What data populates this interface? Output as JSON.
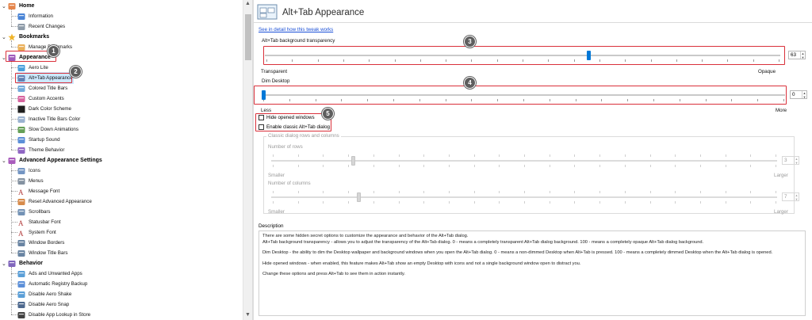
{
  "tree": {
    "items": [
      {
        "type": "cat",
        "label": "Home",
        "icon": "home-icon"
      },
      {
        "type": "item",
        "label": "Information",
        "icon": "info-icon"
      },
      {
        "type": "item",
        "label": "Recent Changes",
        "icon": "recent-icon"
      },
      {
        "type": "cat",
        "label": "Bookmarks",
        "icon": "star-icon"
      },
      {
        "type": "item",
        "label": "Manage Bookmarks",
        "icon": "bookmark-icon"
      },
      {
        "type": "cat",
        "label": "Appearance",
        "icon": "appearance-icon"
      },
      {
        "type": "item",
        "label": "Aero Lite",
        "icon": "aero-lite-icon"
      },
      {
        "type": "item",
        "label": "Alt+Tab Appearance",
        "icon": "alt-tab-icon",
        "selected": true
      },
      {
        "type": "item",
        "label": "Colored Title Bars",
        "icon": "title-bars-icon"
      },
      {
        "type": "item",
        "label": "Custom Accents",
        "icon": "accents-icon"
      },
      {
        "type": "item",
        "label": "Dark Color Scheme",
        "icon": "dark-scheme-icon"
      },
      {
        "type": "item",
        "label": "Inactive Title Bars Color",
        "icon": "inactive-title-icon"
      },
      {
        "type": "item",
        "label": "Slow Down Animations",
        "icon": "animations-icon"
      },
      {
        "type": "item",
        "label": "Startup Sound",
        "icon": "sound-icon"
      },
      {
        "type": "item",
        "label": "Theme Behavior",
        "icon": "theme-icon"
      },
      {
        "type": "cat",
        "label": "Advanced Appearance Settings",
        "icon": "advanced-appearance-icon"
      },
      {
        "type": "item",
        "label": "Icons",
        "icon": "icons-icon"
      },
      {
        "type": "item",
        "label": "Menus",
        "icon": "menus-icon"
      },
      {
        "type": "item",
        "label": "Message Font",
        "icon": "font-icon"
      },
      {
        "type": "item",
        "label": "Reset Advanced Appearance",
        "icon": "reset-icon"
      },
      {
        "type": "item",
        "label": "Scrollbars",
        "icon": "scrollbars-icon"
      },
      {
        "type": "item",
        "label": "Statusbar Font",
        "icon": "font-icon"
      },
      {
        "type": "item",
        "label": "System Font",
        "icon": "font-icon"
      },
      {
        "type": "item",
        "label": "Window Borders",
        "icon": "window-icon"
      },
      {
        "type": "item",
        "label": "Window Title Bars",
        "icon": "window-icon"
      },
      {
        "type": "cat",
        "label": "Behavior",
        "icon": "behavior-icon"
      },
      {
        "type": "item",
        "label": "Ads and Unwanted Apps",
        "icon": "ads-icon"
      },
      {
        "type": "item",
        "label": "Automatic Registry Backup",
        "icon": "registry-icon"
      },
      {
        "type": "item",
        "label": "Disable Aero Shake",
        "icon": "aero-shake-icon"
      },
      {
        "type": "item",
        "label": "Disable Aero Snap",
        "icon": "aero-snap-icon"
      },
      {
        "type": "item",
        "label": "Disable App Lookup in Store",
        "icon": "store-icon"
      }
    ]
  },
  "panel": {
    "title": "Alt+Tab Appearance",
    "detail_link": "See in detail how this tweak works",
    "transparency": {
      "label": "Alt+Tab background transparency",
      "value": "63",
      "level": 0.63,
      "min_label": "Transparent",
      "max_label": "Opaque"
    },
    "dim": {
      "label": "Dim Desktop",
      "value": "0",
      "level": 0.0,
      "min_label": "Less",
      "max_label": "More"
    },
    "hide_windows": {
      "label": "Hide opened windows",
      "checked": false
    },
    "classic_dialog": {
      "label": "Enable classic Alt+Tab dialog",
      "checked": false
    },
    "classic_group": {
      "title": "Classic dialog rows and columns",
      "rows_label": "Number of rows",
      "rows_value": "3",
      "rows_min": "Smaller",
      "rows_max": "Larger",
      "cols_label": "Number of columns",
      "cols_value": "7",
      "cols_min": "Smaller",
      "cols_max": "Larger"
    },
    "description": {
      "title": "Description",
      "p1a": "There are some hidden secret options to customize the appearance and behavior of the Alt+Tab dialog.",
      "p1b": "Alt+Tab background transparency - allows you to adjust the transparency of the Alt+Tab dialog. 0 - means a completely transparent Alt+Tab dialog background. 100 - means a completely opaque Alt+Tab dialog background.",
      "p2": "Dim Desktop - the ability to dim the Desktop wallpaper and background windows when you open the Alt+Tab dialog. 0 - means a non-dimmed Desktop when Alt+Tab is pressed. 100 - means a completely dimmed Desktop when the Alt+Tab dialog is opened.",
      "p3": "Hide opened windows - when enabled, this feature makes Alt+Tab show an empty Desktop with icons and not a single background window open to distract you.",
      "p4": "Change these options and press Alt+Tab to see them in action instantly."
    }
  },
  "annotations": [
    "1",
    "2",
    "3",
    "4",
    "5"
  ],
  "colors": {
    "accent": "#0078d7",
    "highlight": "#d9303a",
    "badge": "#5e5e5e",
    "link": "#1a4fd6"
  }
}
